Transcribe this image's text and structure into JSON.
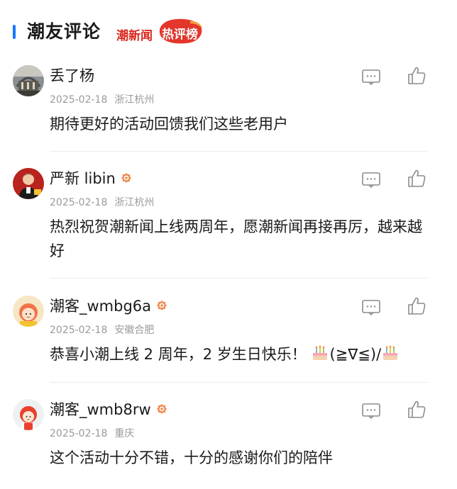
{
  "header": {
    "title": "潮友评论",
    "logo_text": "潮新闻",
    "logo_badge_text": "热评榜",
    "accent_color": "#1677ff",
    "logo_color": "#d9261c"
  },
  "comments": [
    {
      "username": "丢了杨",
      "verified": false,
      "date": "2025-02-18",
      "location": "浙江杭州",
      "content": "期待更好的活动回馈我们这些老用户",
      "avatar": "photo-avatar"
    },
    {
      "username": "严新 libin",
      "verified": true,
      "date": "2025-02-18",
      "location": "浙江杭州",
      "content": "热烈祝贺潮新闻上线两周年，愿潮新闻再接再厉，越来越好",
      "avatar": "photo-avatar"
    },
    {
      "username": "潮客_wmbg6a",
      "verified": true,
      "date": "2025-02-18",
      "location": "安徽合肥",
      "content_pre": "恭喜小潮上线 2 周年，2 岁生日快乐！",
      "content_kaomoji": "(≧∇≦)/",
      "avatar": "cartoon-girl-avatar"
    },
    {
      "username": "潮客_wmb8rw",
      "verified": true,
      "date": "2025-02-18",
      "location": "重庆",
      "content": "这个活动十分不错，十分的感谢你们的陪伴",
      "avatar": "cartoon-girl-avatar"
    }
  ],
  "icons": {
    "reply": "comment-icon",
    "like": "thumbs-up-icon",
    "verified": "verified-badge-icon",
    "cake": "birthday-cake-icon"
  }
}
